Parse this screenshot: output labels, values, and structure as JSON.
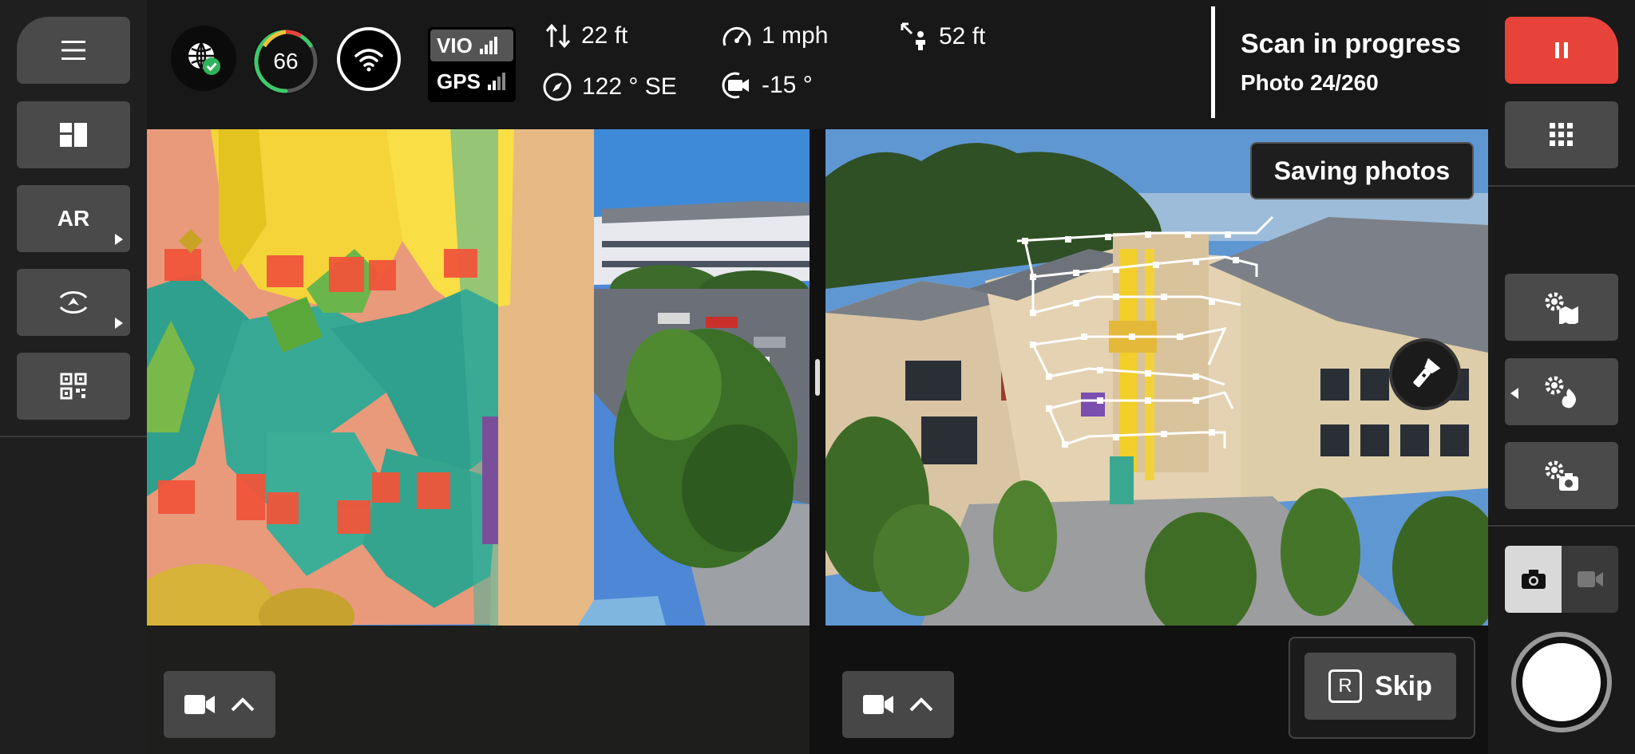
{
  "top_bar": {
    "battery_percent": "66",
    "vio_label": "VIO",
    "gps_label": "GPS",
    "altitude": "22 ft",
    "speed": "1 mph",
    "distance": "52 ft",
    "heading": "122 ° SE",
    "gimbal_pitch": "-15 °"
  },
  "scan_status": {
    "title": "Scan in progress",
    "photo_progress": "Photo 24/260"
  },
  "left_sidebar": {
    "ar_label": "AR"
  },
  "right_view": {
    "saving_label": "Saving photos",
    "skip_key": "R",
    "skip_label": "Skip"
  },
  "colors": {
    "pause_red": "#e8433a",
    "battery_green": "#3ec86b",
    "panel_gray": "#4a4a4a"
  },
  "icons": {
    "menu": "menu-icon",
    "layout": "layout-icon",
    "orbit": "orbit-icon",
    "qr": "qr-code-icon",
    "globe": "globe-check-icon",
    "wifi": "wifi-icon",
    "pause": "pause-icon",
    "grid": "grid-icon",
    "map_settings": "map-settings-icon",
    "fire_settings": "flame-settings-icon",
    "camera_settings": "camera-settings-icon",
    "photo_mode": "camera-icon",
    "video_mode": "video-icon",
    "flashlight": "flashlight-icon",
    "shutter": "shutter-icon"
  }
}
